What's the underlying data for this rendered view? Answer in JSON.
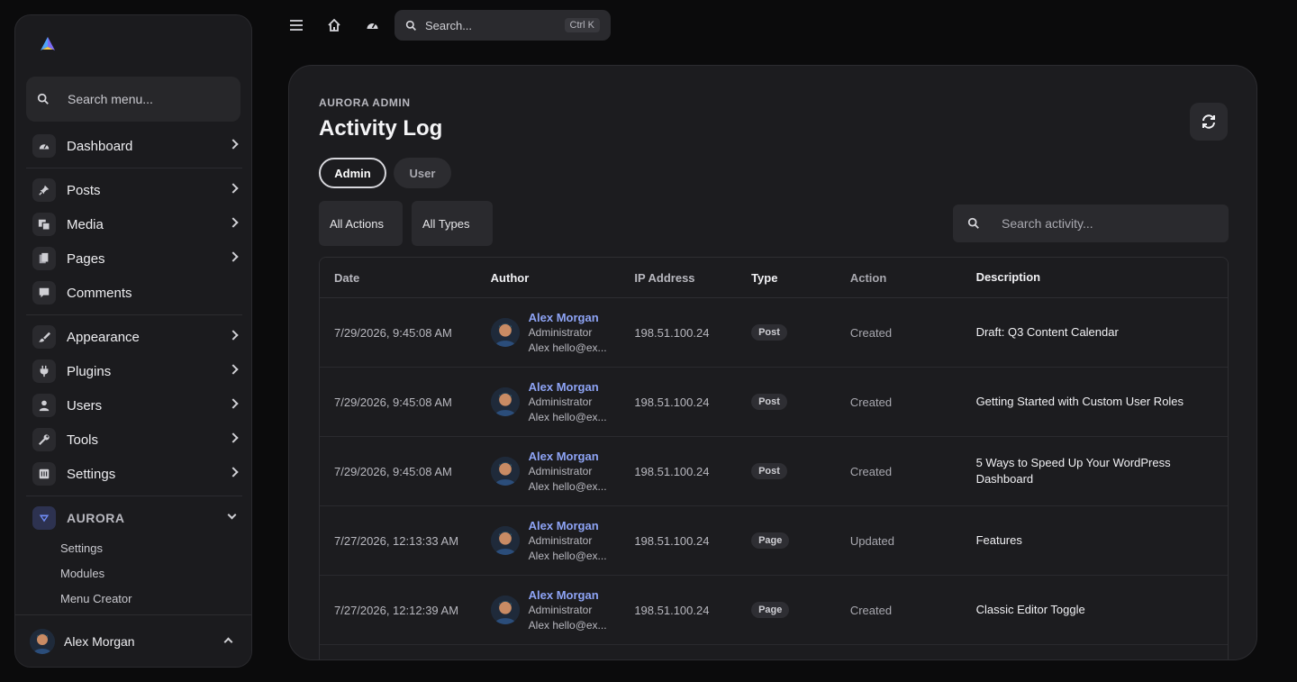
{
  "sidebar": {
    "logo_icon": "aurora-logo-icon",
    "search_placeholder": "Search menu...",
    "items": [
      {
        "label": "Dashboard",
        "icon": "dashboard-icon"
      },
      {
        "label": "Posts",
        "icon": "pin-icon"
      },
      {
        "label": "Media",
        "icon": "media-icon"
      },
      {
        "label": "Pages",
        "icon": "pages-icon"
      },
      {
        "label": "Comments",
        "icon": "comment-icon"
      },
      {
        "label": "Appearance",
        "icon": "brush-icon"
      },
      {
        "label": "Plugins",
        "icon": "plug-icon"
      },
      {
        "label": "Users",
        "icon": "user-icon"
      },
      {
        "label": "Tools",
        "icon": "wrench-icon"
      },
      {
        "label": "Settings",
        "icon": "settings-icon"
      }
    ],
    "aurora": {
      "label": "AURORA",
      "icon": "aurora-icon",
      "sub_items": [
        "Settings",
        "Modules",
        "Menu Creator"
      ]
    },
    "user": {
      "name": "Alex Morgan"
    }
  },
  "topbar": {
    "icons": [
      "menu-icon",
      "home-icon",
      "dashboard-icon"
    ],
    "search_placeholder": "Search...",
    "shortcut": "Ctrl K"
  },
  "main": {
    "eyebrow": "AURORA ADMIN",
    "title": "Activity Log",
    "tabs": [
      {
        "label": "Admin",
        "active": true
      },
      {
        "label": "User",
        "active": false
      }
    ],
    "filters": {
      "actions": "All Actions",
      "types": "All Types"
    },
    "search_placeholder": "Search activity...",
    "table": {
      "columns": [
        "Date",
        "Author",
        "IP Address",
        "Type",
        "Action",
        "Description"
      ],
      "rows": [
        {
          "date": "7/29/2026, 9:45:08 AM",
          "author": "Alex Morgan",
          "role": "Administrator",
          "email": "Alex hello@ex...",
          "ip": "198.51.100.24",
          "type": "Post",
          "action": "Created",
          "description": "Draft: Q3 Content Calendar"
        },
        {
          "date": "7/29/2026, 9:45:08 AM",
          "author": "Alex Morgan",
          "role": "Administrator",
          "email": "Alex hello@ex...",
          "ip": "198.51.100.24",
          "type": "Post",
          "action": "Created",
          "description": "Getting Started with Custom User Roles"
        },
        {
          "date": "7/29/2026, 9:45:08 AM",
          "author": "Alex Morgan",
          "role": "Administrator",
          "email": "Alex hello@ex...",
          "ip": "198.51.100.24",
          "type": "Post",
          "action": "Created",
          "description": "5 Ways to Speed Up Your WordPress Dashboard"
        },
        {
          "date": "7/27/2026, 12:13:33 AM",
          "author": "Alex Morgan",
          "role": "Administrator",
          "email": "Alex hello@ex...",
          "ip": "198.51.100.24",
          "type": "Page",
          "action": "Updated",
          "description": "Features"
        },
        {
          "date": "7/27/2026, 12:12:39 AM",
          "author": "Alex Morgan",
          "role": "Administrator",
          "email": "Alex hello@ex...",
          "ip": "198.51.100.24",
          "type": "Page",
          "action": "Created",
          "description": "Classic Editor Toggle"
        }
      ]
    }
  },
  "colors": {
    "accent": "#8ea4f6",
    "panel": "#1c1c1f",
    "background": "#0b0b0c"
  }
}
